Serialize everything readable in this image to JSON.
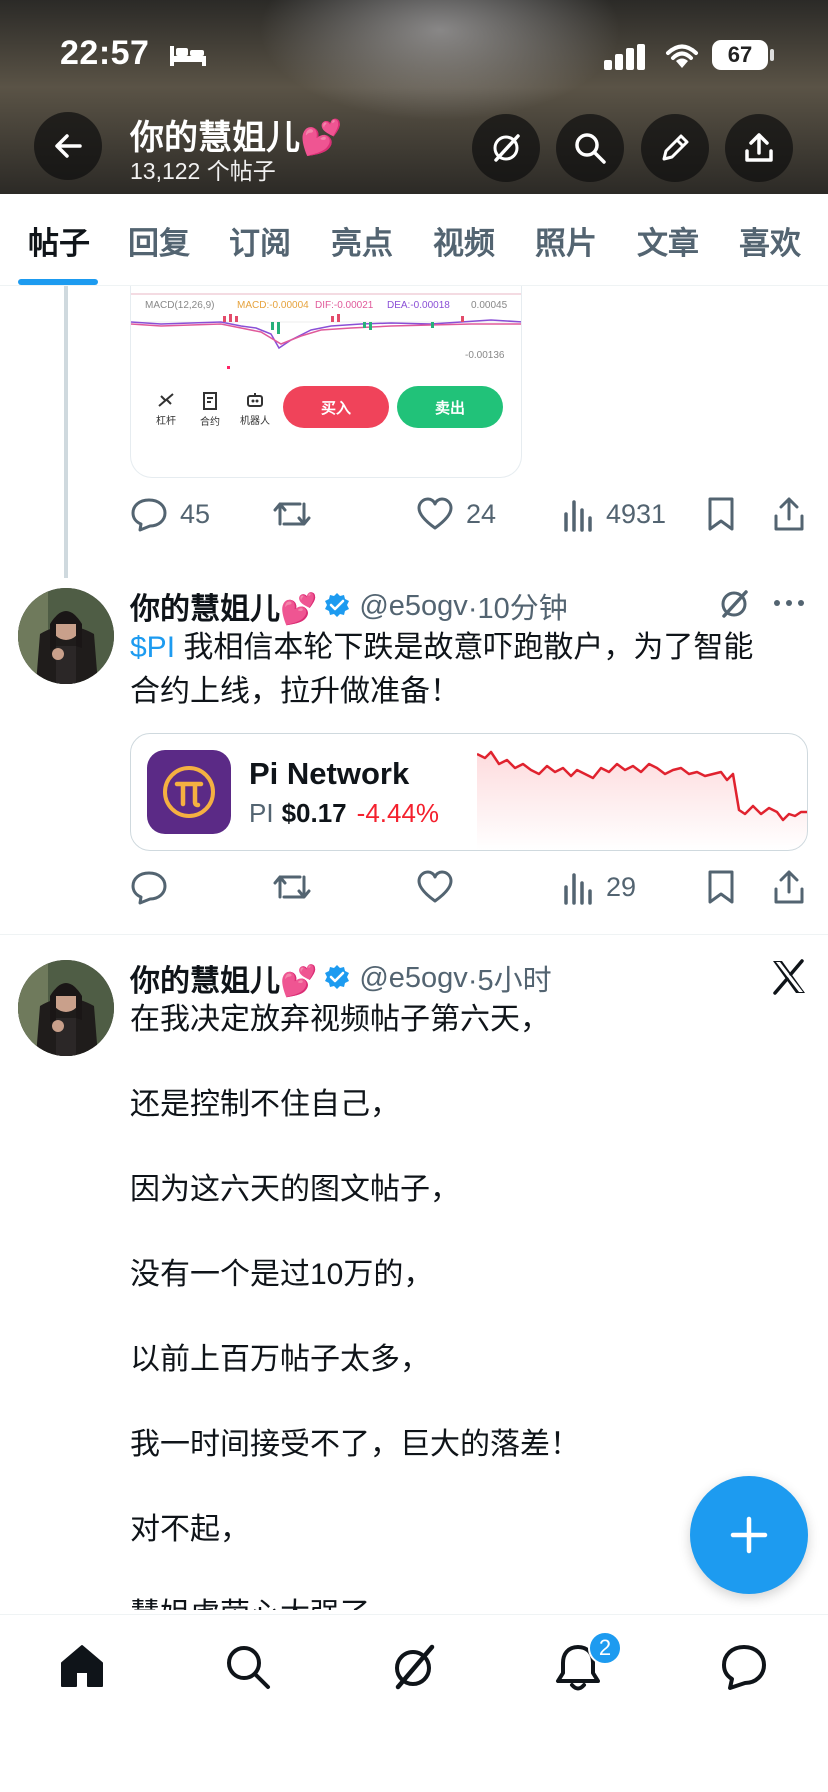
{
  "status_bar": {
    "time": "22:57",
    "battery": "67"
  },
  "header": {
    "title": "你的慧姐儿💕",
    "post_count": "13,122 个帖子"
  },
  "tabs": [
    "帖子",
    "回复",
    "订阅",
    "亮点",
    "视频",
    "照片",
    "文章",
    "喜欢"
  ],
  "media_preview": {
    "macd_label": "MACD(12,26,9)",
    "macd_value": "MACD:-0.00004",
    "dif_value": "DIF:-0.00021",
    "dea_value": "DEA:-0.00018",
    "scale_top": "0.00045",
    "scale_bottom": "-0.00136",
    "tool_lever": "杠杆",
    "tool_contract": "合约",
    "tool_robot": "机器人",
    "buy_label": "买入",
    "sell_label": "卖出"
  },
  "post0_actions": {
    "replies": "45",
    "reposts": "",
    "likes": "24",
    "views": "4931"
  },
  "post1": {
    "name": "你的慧姐儿💕",
    "handle": "@e5ogv",
    "time": "·10分钟",
    "cashtag": "$PI",
    "text_line1": " 我相信本轮下跌是故意吓跑散户，为了智能",
    "text_line2": "合约上线，拉升做准备！",
    "card": {
      "name": "Pi Network",
      "symbol": "PI",
      "price": "$0.17",
      "change": "-4.44%"
    },
    "actions": {
      "replies": "",
      "reposts": "",
      "likes": "",
      "views": "29"
    }
  },
  "post2": {
    "name": "你的慧姐儿💕",
    "handle": "@e5ogv",
    "time": "·5小时",
    "lines": [
      "在我决定放弃视频帖子第六天，",
      "还是控制不住自己，",
      "因为这六天的图文帖子，",
      "没有一个是过10万的，",
      "以前上百万帖子太多，",
      "我一时间接受不了，巨大的落差！",
      "对不起，",
      "慧姐虚荣心太强了，"
    ]
  },
  "bottom_nav": {
    "notifications_badge": "2"
  },
  "colors": {
    "accent": "#1d9bf0",
    "buy": "#f0435a",
    "sell": "#21c279",
    "down": "#f4212e"
  }
}
